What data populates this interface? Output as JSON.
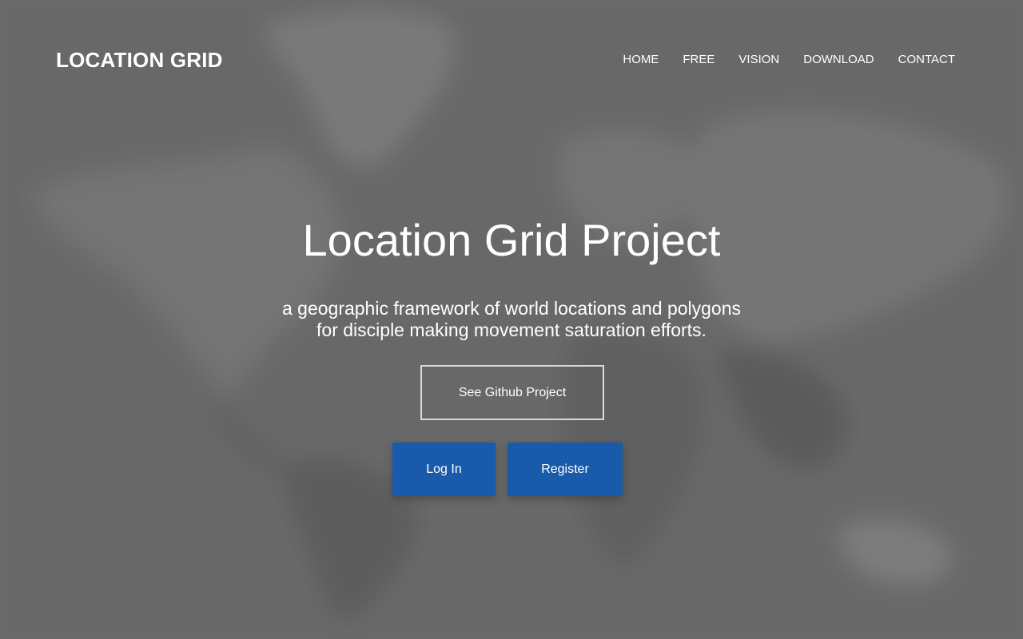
{
  "brand": {
    "logo_text": "LOCATION GRID"
  },
  "nav": {
    "items": [
      {
        "label": "HOME"
      },
      {
        "label": "FREE"
      },
      {
        "label": "VISION"
      },
      {
        "label": "DOWNLOAD"
      },
      {
        "label": "CONTACT"
      }
    ]
  },
  "hero": {
    "title": "Location Grid Project",
    "subtitle_line1": "a geographic framework of world locations and polygons",
    "subtitle_line2": "for disciple making movement saturation efforts.",
    "github_label": "See Github Project",
    "login_label": "Log In",
    "register_label": "Register"
  },
  "colors": {
    "background": "#6e6e6e",
    "accent_button": "#1a5aaa",
    "text": "#ffffff"
  },
  "background_image": "world-map-icon"
}
